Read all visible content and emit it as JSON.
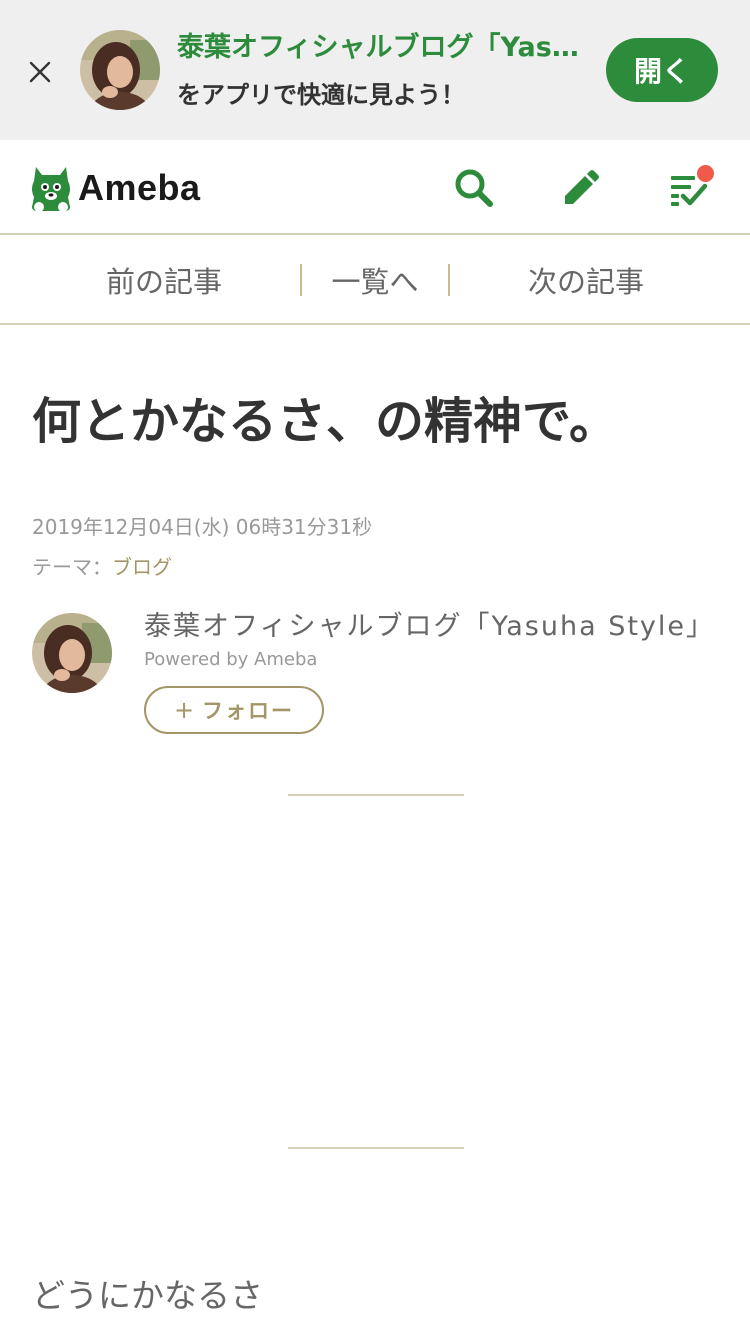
{
  "banner": {
    "title": "泰葉オフィシャルブログ「Yasuha Style」",
    "subtitle": "をアプリで快適に見よう！",
    "open_label": "開く",
    "close_icon": "close-icon",
    "avatar": "author-avatar"
  },
  "header": {
    "logo_text": "Ameba",
    "icons": [
      "search-icon",
      "pencil-icon",
      "reader-list-icon"
    ],
    "brand_color": "#2d8c3c",
    "notification_color": "#f05a4a"
  },
  "article_nav": {
    "prev_label": "前の記事",
    "list_label": "一覧へ",
    "next_label": "次の記事"
  },
  "article": {
    "title": "何とかなるさ、の精神で。",
    "date": "2019年12月04日(水) 06時31分31秒",
    "theme_prefix": "テーマ：",
    "theme_link": "ブログ",
    "body_first_line": "どうにかなるさ"
  },
  "author": {
    "blog_name": "泰葉オフィシャルブログ「Yasuha Style」",
    "powered_by": "Powered by Ameba",
    "follow_label": "フォロー",
    "follow_plus": "+"
  },
  "colors": {
    "accent_gold": "#a39768",
    "divider": "#d6cfb8",
    "banner_bg": "#efefef"
  }
}
